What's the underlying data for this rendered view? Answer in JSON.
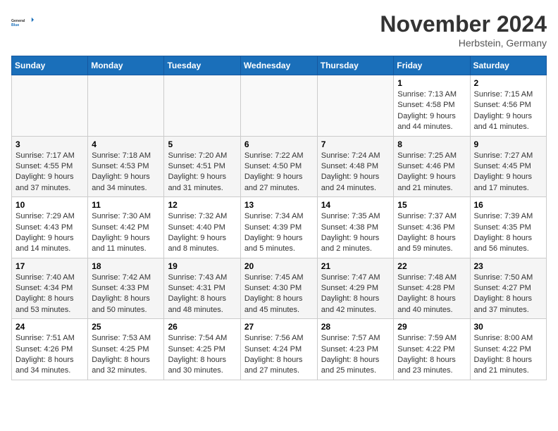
{
  "header": {
    "logo": {
      "general": "General",
      "blue": "Blue"
    },
    "month": "November 2024",
    "location": "Herbstein, Germany"
  },
  "weekdays": [
    "Sunday",
    "Monday",
    "Tuesday",
    "Wednesday",
    "Thursday",
    "Friday",
    "Saturday"
  ],
  "weeks": [
    [
      {
        "day": "",
        "info": ""
      },
      {
        "day": "",
        "info": ""
      },
      {
        "day": "",
        "info": ""
      },
      {
        "day": "",
        "info": ""
      },
      {
        "day": "",
        "info": ""
      },
      {
        "day": "1",
        "info": "Sunrise: 7:13 AM\nSunset: 4:58 PM\nDaylight: 9 hours and 44 minutes."
      },
      {
        "day": "2",
        "info": "Sunrise: 7:15 AM\nSunset: 4:56 PM\nDaylight: 9 hours and 41 minutes."
      }
    ],
    [
      {
        "day": "3",
        "info": "Sunrise: 7:17 AM\nSunset: 4:55 PM\nDaylight: 9 hours and 37 minutes."
      },
      {
        "day": "4",
        "info": "Sunrise: 7:18 AM\nSunset: 4:53 PM\nDaylight: 9 hours and 34 minutes."
      },
      {
        "day": "5",
        "info": "Sunrise: 7:20 AM\nSunset: 4:51 PM\nDaylight: 9 hours and 31 minutes."
      },
      {
        "day": "6",
        "info": "Sunrise: 7:22 AM\nSunset: 4:50 PM\nDaylight: 9 hours and 27 minutes."
      },
      {
        "day": "7",
        "info": "Sunrise: 7:24 AM\nSunset: 4:48 PM\nDaylight: 9 hours and 24 minutes."
      },
      {
        "day": "8",
        "info": "Sunrise: 7:25 AM\nSunset: 4:46 PM\nDaylight: 9 hours and 21 minutes."
      },
      {
        "day": "9",
        "info": "Sunrise: 7:27 AM\nSunset: 4:45 PM\nDaylight: 9 hours and 17 minutes."
      }
    ],
    [
      {
        "day": "10",
        "info": "Sunrise: 7:29 AM\nSunset: 4:43 PM\nDaylight: 9 hours and 14 minutes."
      },
      {
        "day": "11",
        "info": "Sunrise: 7:30 AM\nSunset: 4:42 PM\nDaylight: 9 hours and 11 minutes."
      },
      {
        "day": "12",
        "info": "Sunrise: 7:32 AM\nSunset: 4:40 PM\nDaylight: 9 hours and 8 minutes."
      },
      {
        "day": "13",
        "info": "Sunrise: 7:34 AM\nSunset: 4:39 PM\nDaylight: 9 hours and 5 minutes."
      },
      {
        "day": "14",
        "info": "Sunrise: 7:35 AM\nSunset: 4:38 PM\nDaylight: 9 hours and 2 minutes."
      },
      {
        "day": "15",
        "info": "Sunrise: 7:37 AM\nSunset: 4:36 PM\nDaylight: 8 hours and 59 minutes."
      },
      {
        "day": "16",
        "info": "Sunrise: 7:39 AM\nSunset: 4:35 PM\nDaylight: 8 hours and 56 minutes."
      }
    ],
    [
      {
        "day": "17",
        "info": "Sunrise: 7:40 AM\nSunset: 4:34 PM\nDaylight: 8 hours and 53 minutes."
      },
      {
        "day": "18",
        "info": "Sunrise: 7:42 AM\nSunset: 4:33 PM\nDaylight: 8 hours and 50 minutes."
      },
      {
        "day": "19",
        "info": "Sunrise: 7:43 AM\nSunset: 4:31 PM\nDaylight: 8 hours and 48 minutes."
      },
      {
        "day": "20",
        "info": "Sunrise: 7:45 AM\nSunset: 4:30 PM\nDaylight: 8 hours and 45 minutes."
      },
      {
        "day": "21",
        "info": "Sunrise: 7:47 AM\nSunset: 4:29 PM\nDaylight: 8 hours and 42 minutes."
      },
      {
        "day": "22",
        "info": "Sunrise: 7:48 AM\nSunset: 4:28 PM\nDaylight: 8 hours and 40 minutes."
      },
      {
        "day": "23",
        "info": "Sunrise: 7:50 AM\nSunset: 4:27 PM\nDaylight: 8 hours and 37 minutes."
      }
    ],
    [
      {
        "day": "24",
        "info": "Sunrise: 7:51 AM\nSunset: 4:26 PM\nDaylight: 8 hours and 34 minutes."
      },
      {
        "day": "25",
        "info": "Sunrise: 7:53 AM\nSunset: 4:25 PM\nDaylight: 8 hours and 32 minutes."
      },
      {
        "day": "26",
        "info": "Sunrise: 7:54 AM\nSunset: 4:25 PM\nDaylight: 8 hours and 30 minutes."
      },
      {
        "day": "27",
        "info": "Sunrise: 7:56 AM\nSunset: 4:24 PM\nDaylight: 8 hours and 27 minutes."
      },
      {
        "day": "28",
        "info": "Sunrise: 7:57 AM\nSunset: 4:23 PM\nDaylight: 8 hours and 25 minutes."
      },
      {
        "day": "29",
        "info": "Sunrise: 7:59 AM\nSunset: 4:22 PM\nDaylight: 8 hours and 23 minutes."
      },
      {
        "day": "30",
        "info": "Sunrise: 8:00 AM\nSunset: 4:22 PM\nDaylight: 8 hours and 21 minutes."
      }
    ]
  ]
}
